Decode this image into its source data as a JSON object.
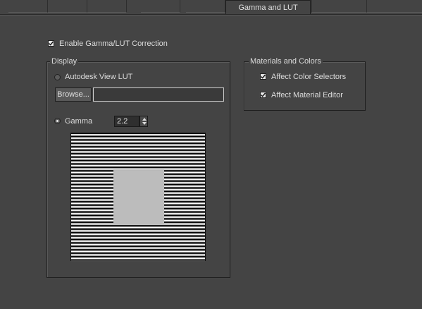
{
  "tabs": {
    "active_label": "Gamma and LUT"
  },
  "enable": {
    "label": "Enable Gamma/LUT Correction",
    "checked": true
  },
  "display": {
    "legend": "Display",
    "lut_label": "Autodesk View LUT",
    "browse_label": "Browse...",
    "path_value": "",
    "gamma_label": "Gamma",
    "gamma_value": "2.2",
    "mode_selected": "gamma"
  },
  "materials": {
    "legend": "Materials and Colors",
    "color_selectors_label": "Affect Color Selectors",
    "color_selectors_checked": true,
    "material_editor_label": "Affect Material Editor",
    "material_editor_checked": true
  },
  "icons": [
    "checkmark-icon",
    "spinner-up-icon",
    "spinner-down-icon"
  ],
  "colors": {
    "panel_bg": "#444444",
    "text": "#dcdcdc",
    "preview_solid": "#bcbcbc"
  }
}
